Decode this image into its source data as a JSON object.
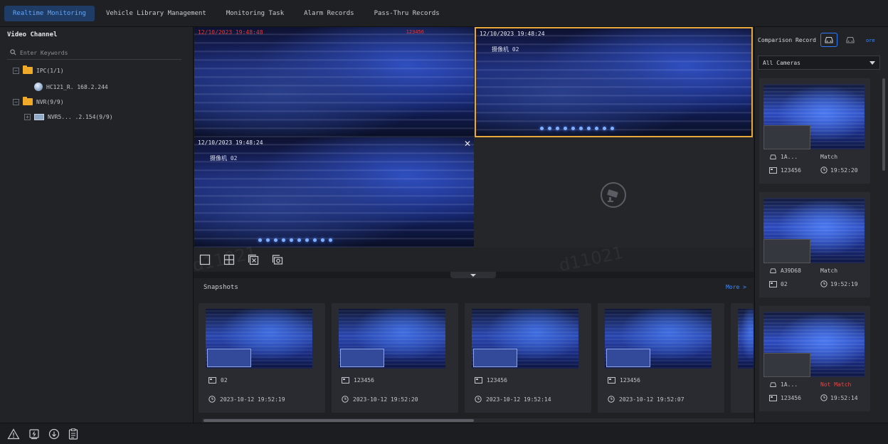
{
  "nav": {
    "tabs": [
      {
        "label": "Realtime Monitoring",
        "active": true
      },
      {
        "label": "Vehicle Library Management"
      },
      {
        "label": "Monitoring Task"
      },
      {
        "label": "Alarm Records"
      },
      {
        "label": "Pass-Thru Records"
      }
    ]
  },
  "sidebar": {
    "title": "Video Channel",
    "search_placeholder": "Enter Keywords",
    "tree": {
      "ipc_group": "IPC(1/1)",
      "ipc_device": "HC121_R. 168.2.244",
      "nvr_group": "NVR(9/9)",
      "nvr_device": "NVR5... .2.154(9/9)"
    }
  },
  "videos": {
    "v1": {
      "timestamp": "12/10/2023 19:48:48",
      "tag": "123456"
    },
    "v2": {
      "timestamp": "12/10/2023 19:48:24",
      "camera": "摄像机 02"
    },
    "v3": {
      "timestamp": "12/10/2023 19:48:24",
      "camera": "摄像机 02"
    }
  },
  "snapshots": {
    "title": "Snapshots",
    "more": "More >",
    "cards": [
      {
        "camera": "02",
        "time": "2023-10-12 19:52:19"
      },
      {
        "camera": "123456",
        "time": "2023-10-12 19:52:20"
      },
      {
        "camera": "123456",
        "time": "2023-10-12 19:52:14"
      },
      {
        "camera": "123456",
        "time": "2023-10-12 19:52:07"
      }
    ]
  },
  "comparison": {
    "title": "Comparison Record",
    "more": "ore",
    "filter": "All Cameras",
    "records": [
      {
        "plate": "1A...",
        "result": "Match",
        "camera": "123456",
        "time": "19:52:20",
        "status": "match"
      },
      {
        "plate": "A39D68",
        "result": "Match",
        "camera": "02",
        "time": "19:52:19",
        "status": "match"
      },
      {
        "plate": "1A...",
        "result": "Not Match",
        "camera": "123456",
        "time": "19:52:14",
        "status": "notmatch"
      }
    ]
  },
  "watermark": "d11021"
}
